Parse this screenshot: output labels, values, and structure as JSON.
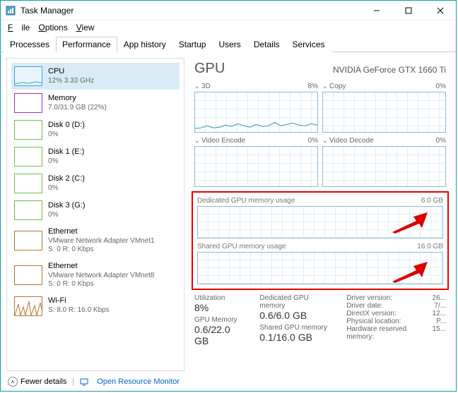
{
  "window": {
    "title": "Task Manager"
  },
  "menu": {
    "file": "File",
    "options": "Options",
    "view": "View"
  },
  "tabs": [
    "Processes",
    "Performance",
    "App history",
    "Startup",
    "Users",
    "Details",
    "Services"
  ],
  "active_tab": 1,
  "sidebar": [
    {
      "name": "CPU",
      "sub": "12% 3.33 GHz",
      "color": "#3aa6dd"
    },
    {
      "name": "Memory",
      "sub": "7.0/31.9 GB (22%)",
      "color": "#a030c0"
    },
    {
      "name": "Disk 0 (D:)",
      "sub": "0%",
      "color": "#6fbf4f"
    },
    {
      "name": "Disk 1 (E:)",
      "sub": "0%",
      "color": "#6fbf4f"
    },
    {
      "name": "Disk 2 (C:)",
      "sub": "0%",
      "color": "#6fbf4f"
    },
    {
      "name": "Disk 3 (G:)",
      "sub": "0%",
      "color": "#6fbf4f"
    },
    {
      "name": "Ethernet",
      "sub": "VMware Network Adapter VMnet1",
      "sub2": "S: 0  R: 0 Kbps",
      "color": "#b87430"
    },
    {
      "name": "Ethernet",
      "sub": "VMware Network Adapter VMnet8",
      "sub2": "S: 0  R: 0 Kbps",
      "color": "#b87430"
    },
    {
      "name": "Wi-Fi",
      "sub": "S: 8.0  R: 16.0 Kbps",
      "color": "#b87430",
      "wave": true
    }
  ],
  "gpu": {
    "title": "GPU",
    "name": "NVIDIA GeForce GTX 1660 Ti",
    "g1": {
      "label": "3D",
      "pct": "8%"
    },
    "g2": {
      "label": "Copy",
      "pct": "0%"
    },
    "g3": {
      "label": "Video Encode",
      "pct": "0%"
    },
    "g4": {
      "label": "Video Decode",
      "pct": "0%"
    },
    "dedicated": {
      "label": "Dedicated GPU memory usage",
      "max": "6.0 GB"
    },
    "shared": {
      "label": "Shared GPU memory usage",
      "max": "16.0 GB"
    }
  },
  "stats": {
    "util_k": "Utilization",
    "util_v": "8%",
    "gmem_k": "GPU Memory",
    "gmem_v": "0.6/22.0 GB",
    "ded_k": "Dedicated GPU memory",
    "ded_v": "0.6/6.0 GB",
    "sha_k": "Shared GPU memory",
    "sha_v": "0.1/16.0 GB"
  },
  "info": {
    "r1k": "Driver version:",
    "r1v": "26...",
    "r2k": "Driver date:",
    "r2v": "7/...",
    "r3k": "DirectX version:",
    "r3v": "12...",
    "r4k": "Physical location:",
    "r4v": "P...",
    "r5k": "Hardware reserved memory:",
    "r5v": "15..."
  },
  "footer": {
    "fewer": "Fewer details",
    "link": "Open Resource Monitor"
  },
  "chart_data": {
    "type": "line",
    "title": "GPU usage",
    "panels": [
      {
        "name": "3D",
        "ylim": [
          0,
          100
        ],
        "values": [
          5,
          6,
          9,
          6,
          7,
          10,
          8,
          12,
          9,
          7,
          11,
          8,
          9,
          14,
          9,
          11,
          13,
          10,
          9,
          12,
          10
        ]
      },
      {
        "name": "Copy",
        "ylim": [
          0,
          100
        ],
        "values": [
          0,
          0,
          0,
          0,
          0,
          0,
          0,
          0,
          0,
          0,
          0,
          0,
          0,
          0,
          0,
          0,
          0,
          0,
          0,
          0,
          0
        ]
      },
      {
        "name": "Video Encode",
        "ylim": [
          0,
          100
        ],
        "values": [
          0,
          0,
          0,
          0,
          0,
          0,
          0,
          0,
          0,
          0,
          0,
          0,
          0,
          0,
          0,
          0,
          0,
          0,
          0,
          0,
          0
        ]
      },
      {
        "name": "Video Decode",
        "ylim": [
          0,
          100
        ],
        "values": [
          0,
          0,
          0,
          0,
          0,
          0,
          0,
          0,
          0,
          0,
          0,
          0,
          0,
          0,
          0,
          0,
          0,
          0,
          0,
          0,
          0
        ]
      },
      {
        "name": "Dedicated GPU memory usage",
        "ylim": [
          0,
          6
        ],
        "unit": "GB",
        "values": [
          0.6,
          0.6,
          0.6,
          0.6,
          0.6,
          0.6,
          0.6,
          0.6,
          0.6,
          0.6,
          0.6,
          0.6,
          0.6,
          0.6,
          0.6,
          0.6,
          0.6,
          0.6,
          0.6,
          0.6,
          0.6
        ]
      },
      {
        "name": "Shared GPU memory usage",
        "ylim": [
          0,
          16
        ],
        "unit": "GB",
        "values": [
          0.1,
          0.1,
          0.1,
          0.1,
          0.1,
          0.1,
          0.1,
          0.1,
          0.1,
          0.1,
          0.1,
          0.1,
          0.1,
          0.1,
          0.1,
          0.1,
          0.1,
          0.1,
          0.1,
          0.1,
          0.1
        ]
      }
    ]
  }
}
